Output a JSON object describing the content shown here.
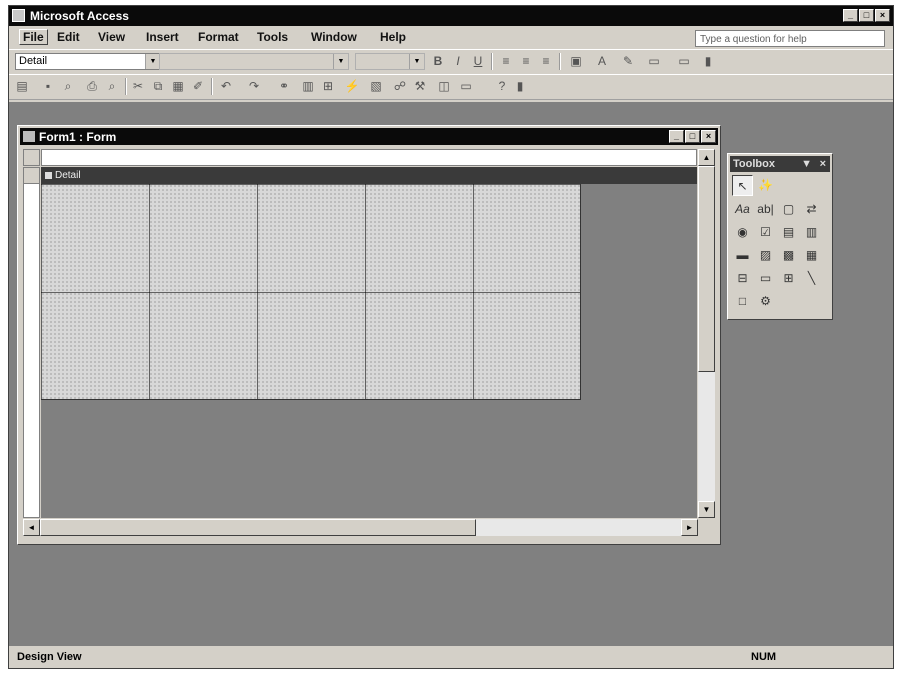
{
  "app": {
    "title": "Microsoft Access"
  },
  "menubar": {
    "items": [
      "File",
      "Edit",
      "View",
      "Insert",
      "Format",
      "Tools",
      "Window",
      "Help"
    ]
  },
  "help": {
    "placeholder": "Type a question for help"
  },
  "toolbar1": {
    "object_selector": "Detail"
  },
  "form_window": {
    "title": "Form1 : Form",
    "section_label": "Detail"
  },
  "toolbox": {
    "title": "Toolbox",
    "tool_icons": [
      "select-objects-icon",
      "control-wizards-icon",
      "label-icon",
      "text-box-icon",
      "option-group-icon",
      "toggle-button-icon",
      "option-button-icon",
      "check-box-icon",
      "combo-box-icon",
      "list-box-icon",
      "command-button-icon",
      "image-icon",
      "unbound-object-frame-icon",
      "bound-object-frame-icon",
      "page-break-icon",
      "tab-control-icon",
      "subform-icon",
      "line-icon",
      "rectangle-icon",
      "more-controls-icon"
    ]
  },
  "statusbar": {
    "left": "Design View",
    "num": "NUM"
  }
}
